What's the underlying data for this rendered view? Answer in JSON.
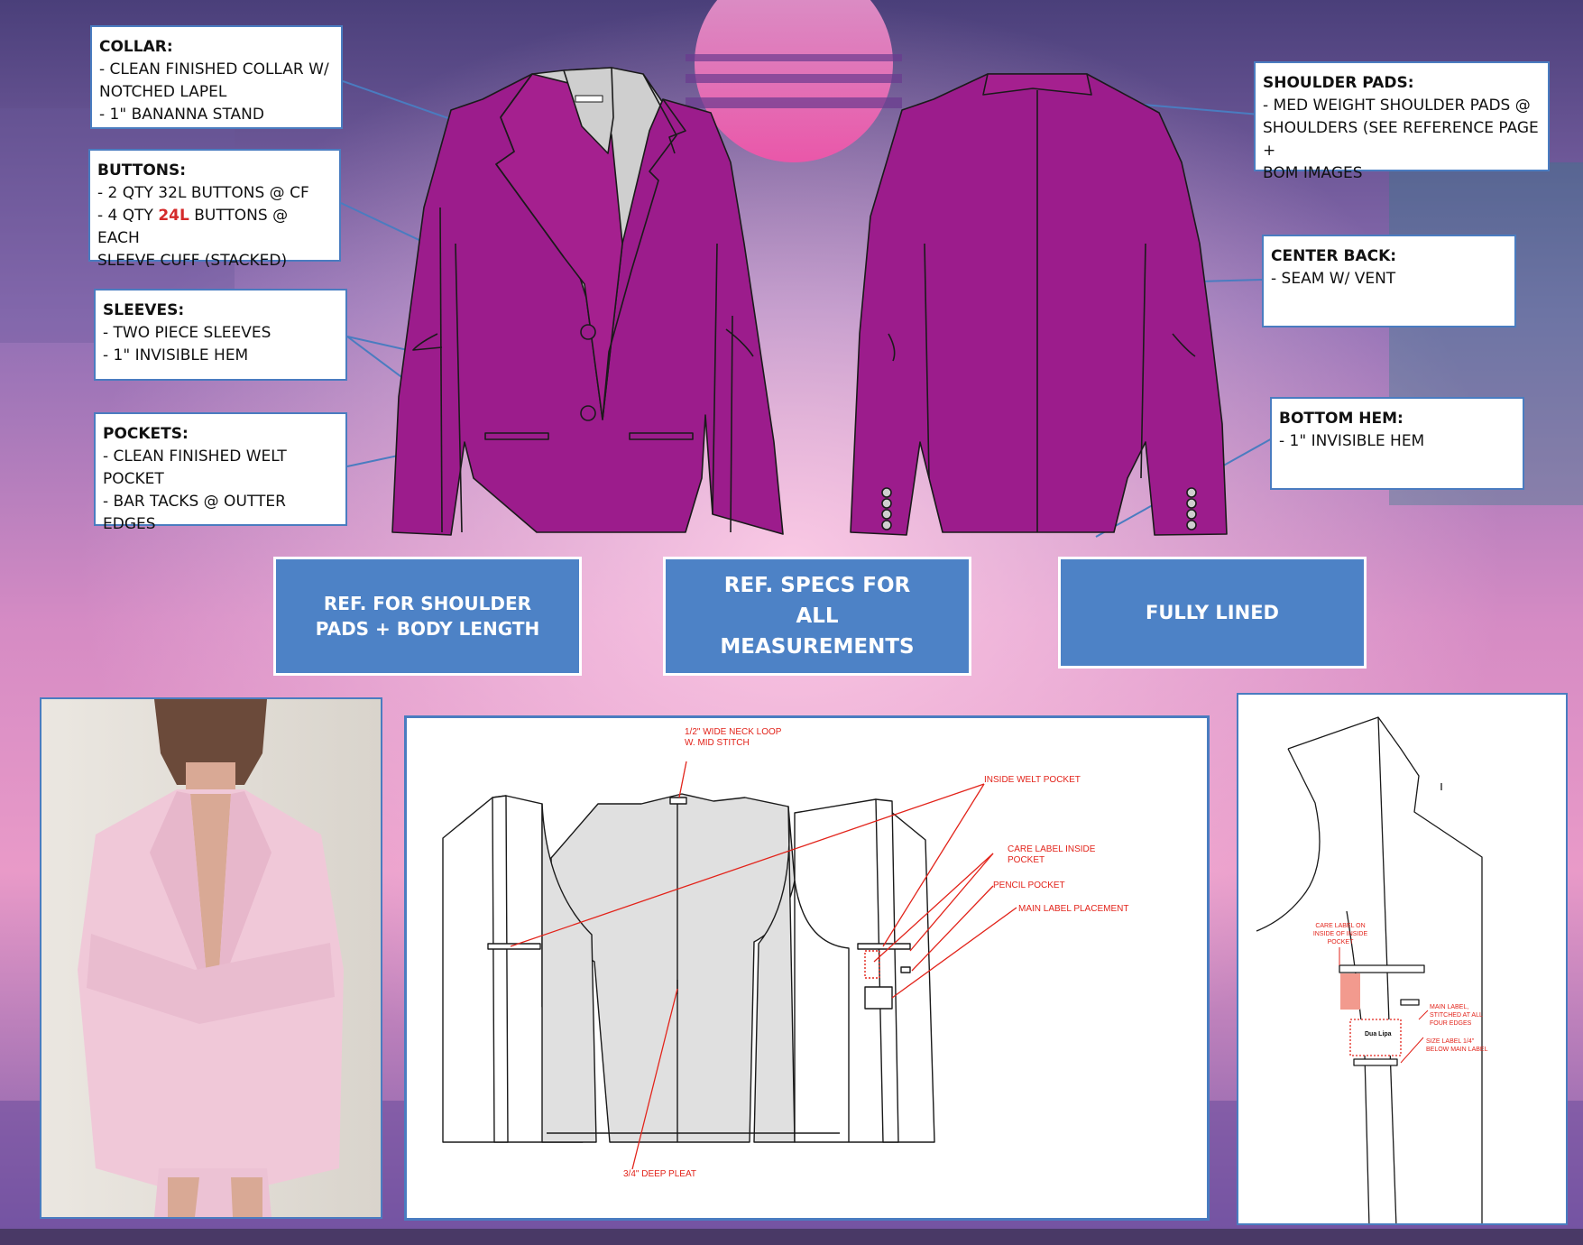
{
  "callouts": {
    "collar": {
      "title": "COLLAR:",
      "lines": [
        "- CLEAN FINISHED COLLAR W/",
        "NOTCHED LAPEL",
        "- 1\" BANANNA STAND"
      ]
    },
    "buttons": {
      "title": "BUTTONS:",
      "line1": "- 2 QTY 32L BUTTONS @ CF",
      "line2_pre": "- 4 QTY ",
      "line2_red": "24L",
      "line2_post": " BUTTONS @ EACH",
      "line3": "SLEEVE CUFF (STACKED)"
    },
    "sleeves": {
      "title": "SLEEVES:",
      "lines": [
        "- TWO PIECE SLEEVES",
        "- 1\" INVISIBLE HEM"
      ]
    },
    "pockets": {
      "title": "POCKETS:",
      "lines": [
        "- CLEAN FINISHED WELT",
        "POCKET",
        "- BAR TACKS @ OUTTER EDGES"
      ]
    },
    "shoulder_pads": {
      "title": "SHOULDER PADS:",
      "lines": [
        "- MED WEIGHT SHOULDER PADS @",
        "SHOULDERS (SEE REFERENCE PAGE +",
        "BOM IMAGES"
      ]
    },
    "center_back": {
      "title": "CENTER BACK:",
      "lines": [
        "- SEAM W/ VENT"
      ]
    },
    "bottom_hem": {
      "title": "BOTTOM HEM:",
      "lines": [
        "- 1\" INVISIBLE HEM"
      ]
    }
  },
  "ref_boxes": {
    "shoulder": "REF. FOR SHOULDER PADS + BODY LENGTH",
    "specs": "REF. SPECS FOR ALL MEASUREMENTS",
    "lined": "FULLY LINED"
  },
  "inside_labels": {
    "neck_loop": "1/2\" WIDE NECK LOOP W. MID STITCH",
    "welt": "INSIDE WELT POCKET",
    "care": "CARE LABEL INSIDE POCKET",
    "pencil": "PENCIL POCKET",
    "main": "MAIN LABEL PLACEMENT",
    "pleat": "3/4\" DEEP PLEAT"
  },
  "detail_labels": {
    "care": "CARE LABEL ON INSIDE OF INSIDE POCKET",
    "main": "MAIN LABEL, STITCHED AT ALL FOUR EDGES",
    "size": "SIZE LABEL 1/4\" BELOW MAIN LABEL",
    "brand": "Dua Lipa"
  },
  "colors": {
    "jacket": "#9c1c8c",
    "callout_border": "#4a7cc0",
    "ref_fill": "#4d82c6",
    "annotation_red": "#e2231a",
    "reference_pink": "#f0c8d8"
  }
}
